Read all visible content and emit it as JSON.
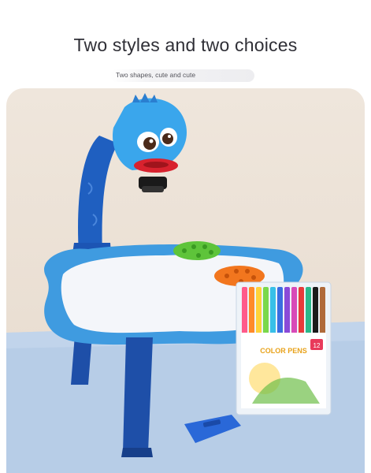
{
  "header": {
    "title": "Two styles and two choices",
    "subtitle": "Two shapes, cute and cute"
  },
  "product": {
    "pen_box_brand": "COLOR PENS",
    "pen_box_count": "12",
    "pen_colors": [
      "#ff5a8a",
      "#ff8a2a",
      "#ffd23a",
      "#7ad84a",
      "#38c0e8",
      "#3a6de0",
      "#8a4ad8",
      "#d84ab8",
      "#e83a3a",
      "#2ab88a",
      "#1a1a1a",
      "#b06a3a"
    ]
  },
  "colors": {
    "toy_blue": "#3f9be0",
    "toy_dark_blue": "#1f4fb0",
    "background_wall": "#ece2d7",
    "floor": "#b9cfe8"
  }
}
